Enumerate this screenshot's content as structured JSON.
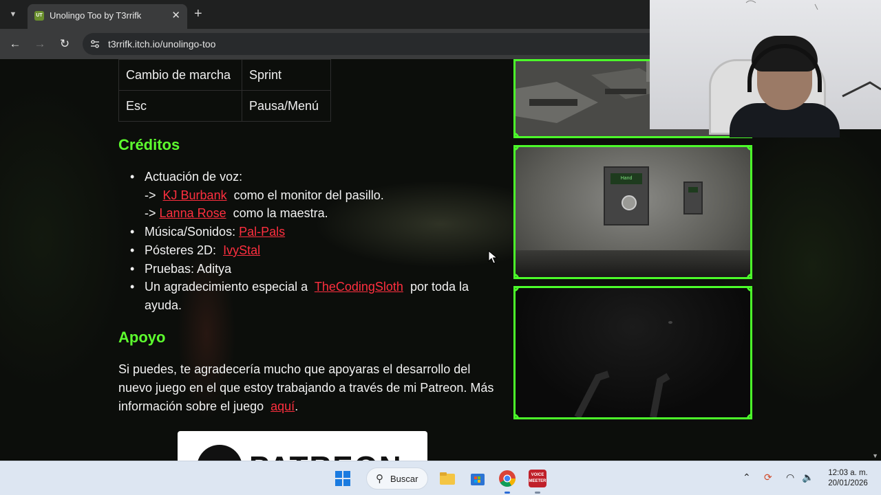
{
  "browser": {
    "tab_title": "Unolingo Too by T3rrifk",
    "tab_favicon_text": "UT",
    "url": "t3rrifk.itch.io/unolingo-too",
    "new_tab_symbol": "+",
    "close_symbol": "✕"
  },
  "controls_table": [
    {
      "key": "Cambio de marcha",
      "action": "Sprint"
    },
    {
      "key": "Esc",
      "action": "Pausa/Menú"
    }
  ],
  "credits": {
    "heading": "Créditos",
    "voice_label": "Actuación de voz:",
    "voice_1_prefix": "->",
    "voice_1_link": "KJ Burbank",
    "voice_1_suffix": "como el monitor del pasillo.",
    "voice_2_prefix": "->",
    "voice_2_link": "Lanna Rose",
    "voice_2_suffix": "como la maestra.",
    "music_label": "Música/Sonidos:",
    "music_link": "Pal-Pals",
    "posters_label": "Pósteres 2D:",
    "posters_link": "IvyStal",
    "testing": "Pruebas: Aditya",
    "thanks_prefix": "Un agradecimiento especial a",
    "thanks_link": "TheCodingSloth",
    "thanks_suffix": "por toda la ayuda."
  },
  "support": {
    "heading": "Apoyo",
    "text": "Si puedes, te agradecería mucho que apoyaras el desarrollo del nuevo juego en el que estoy trabajando a través de mi Patreon.",
    "more_prefix": "Más información sobre el juego",
    "more_link": "aquí",
    "more_suffix": "."
  },
  "patreon_banner": "PATREON",
  "screenshot_panel_label": "Hand",
  "taskbar": {
    "search_label": "Buscar",
    "time": "12:03 a. m.",
    "date": "20/01/2026",
    "voicemeeter_label": "VOICE MEETER"
  },
  "colors": {
    "accent_green": "#5dff2e",
    "link_red": "#ff2f3f",
    "frame_green": "#4cff2a"
  }
}
